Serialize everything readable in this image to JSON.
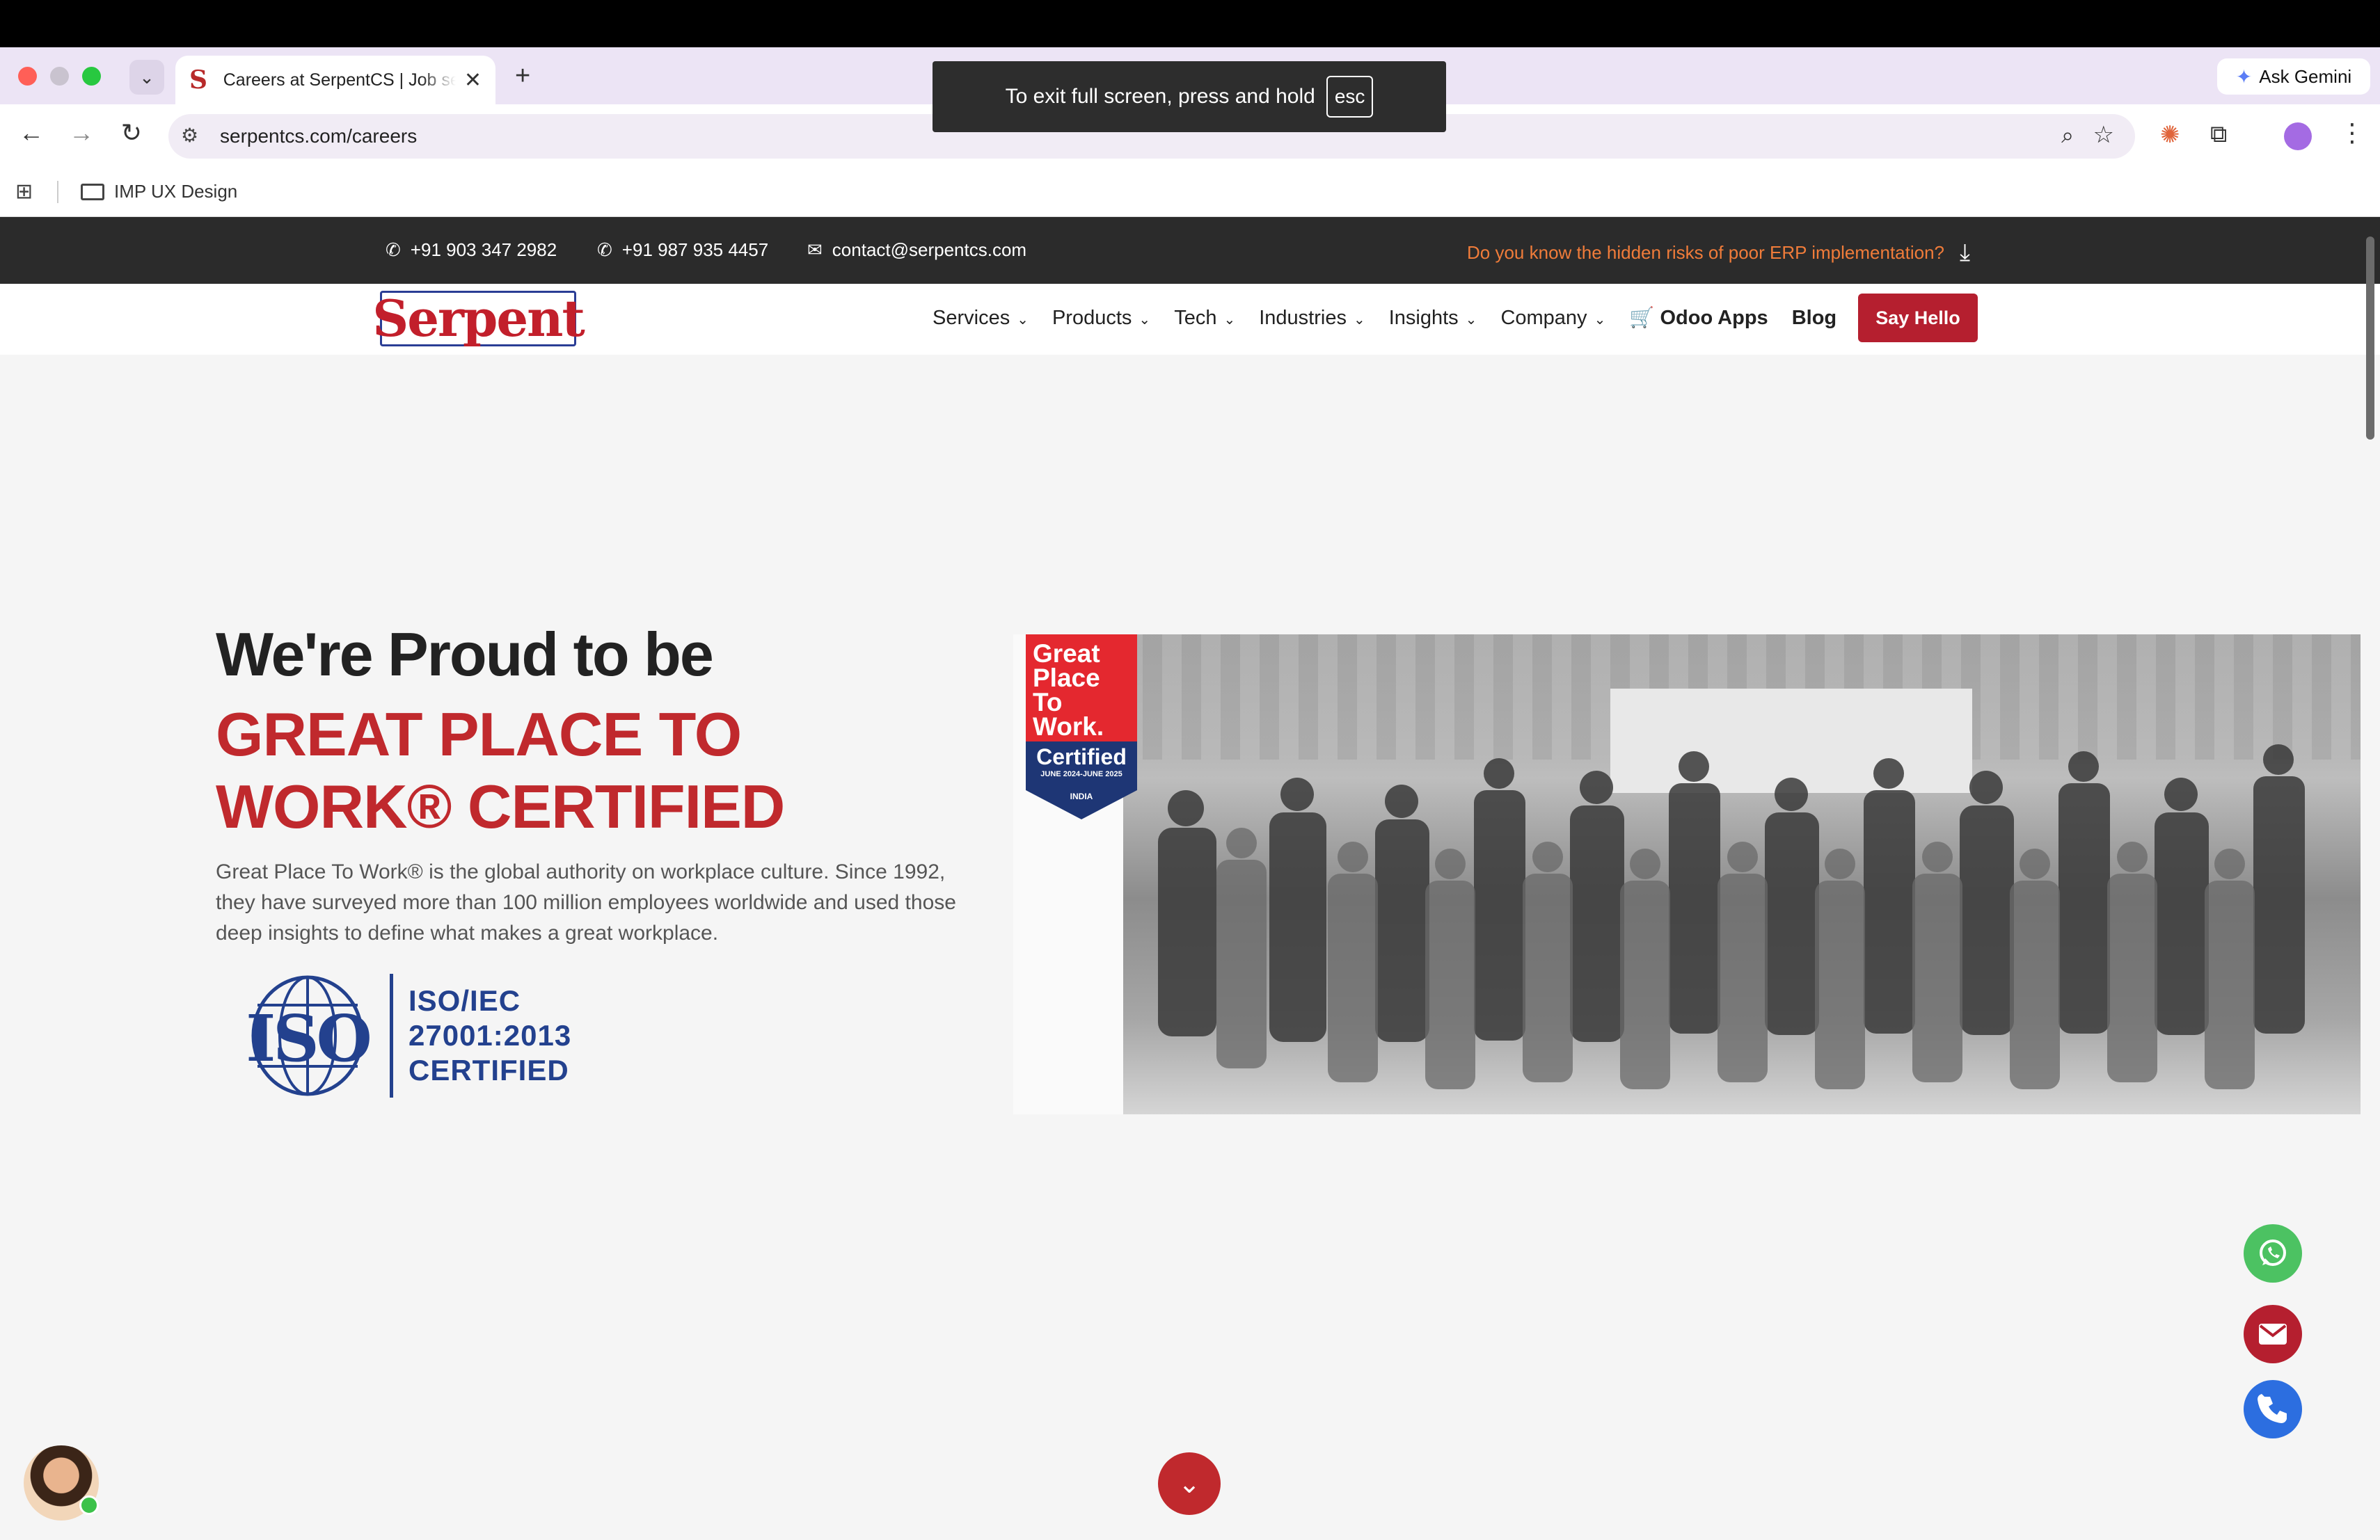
{
  "browser": {
    "tab_title": "Careers at SerpentCS | Job se",
    "tab_favicon": "S",
    "url": "serpentcs.com/careers",
    "gemini_label": "Ask Gemini",
    "bookmark_folder": "IMP UX Design",
    "fullscreen_toast": "To exit full screen, press and hold",
    "fullscreen_key": "esc"
  },
  "infobar": {
    "phone1": "+91 903 347 2982",
    "phone2": "+91 987 935 4457",
    "email": "contact@serpentcs.com",
    "risk_link": "Do you know the hidden risks of poor ERP implementation?"
  },
  "nav": {
    "logo": "Serpent",
    "items": [
      {
        "label": "Services"
      },
      {
        "label": "Products"
      },
      {
        "label": "Tech"
      },
      {
        "label": "Industries"
      },
      {
        "label": "Insights"
      },
      {
        "label": "Company"
      }
    ],
    "odoo_apps": "Odoo Apps",
    "blog": "Blog",
    "cta": "Say Hello"
  },
  "hero": {
    "heading": "We're Proud to be",
    "subheading": "GREAT PLACE TO WORK® CERTIFIED",
    "body": "Great Place To Work® is the global authority on workplace culture. Since 1992, they have surveyed more than 100 million employees worldwide and used those deep insights to define what makes a great workplace.",
    "iso": {
      "mark": "ISO",
      "line1": "ISO/IEC",
      "line2": "27001:2013",
      "line3": "CERTIFIED"
    },
    "badge": {
      "title": "Great Place To Work.",
      "certified": "Certified",
      "dates": "JUNE 2024-JUNE 2025",
      "country": "INDIA"
    }
  },
  "colors": {
    "brand_red": "#c0292d",
    "iso_blue": "#23418e",
    "whatsapp": "#4cc262",
    "phone": "#2c6ee0"
  }
}
